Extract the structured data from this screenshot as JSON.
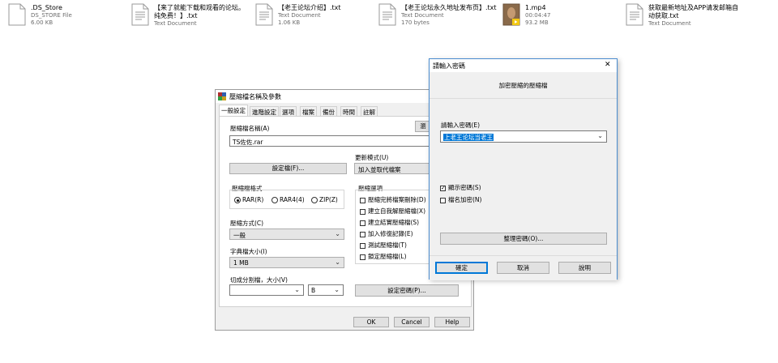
{
  "files": [
    {
      "name": ".DS_Store",
      "line2": "DS_STORE File",
      "line3": "6.00 KB",
      "icon": "blank-file-icon"
    },
    {
      "name": "【来了就能下载和观看的论坛。",
      "line2": "纯免费！】.txt",
      "line3": "Text Document",
      "icon": "text-file-icon"
    },
    {
      "name": "【老王论坛介绍】.txt",
      "line2": "Text Document",
      "line3": "1.06 KB",
      "icon": "text-file-icon"
    },
    {
      "name": "【老王论坛永久地址发布页】.txt",
      "line2": "Text Document",
      "line3": "170 bytes",
      "icon": "text-file-icon"
    },
    {
      "name": "1.mp4",
      "line2": "00:04:47",
      "line3": "93.2 MB",
      "icon": "video-thumbnail-icon"
    },
    {
      "name": "获取最新地址及APP请发邮箱自",
      "line2": "动获取.txt",
      "line3": "Text Document",
      "icon": "text-file-icon"
    }
  ],
  "archive_dialog": {
    "title": "壓縮檔名稱及參數",
    "tabs": [
      "一般設定",
      "進階設定",
      "選項",
      "檔案",
      "備份",
      "時間",
      "註解"
    ],
    "archive_name_label": "壓縮檔名稱(A)",
    "archive_name_value": "TS佐佐.rar",
    "browse_button": "瀏",
    "profiles_button": "設定檔(F)...",
    "update_mode_label": "更新模式(U)",
    "update_mode_value": "加入並取代檔案",
    "format_group_label": "壓縮檔格式",
    "formats": [
      "RAR(R)",
      "RAR4(4)",
      "ZIP(Z)"
    ],
    "method_label": "壓縮方式(C)",
    "method_value": "一般",
    "dict_label": "字典檔大小(I)",
    "dict_value": "1 MB",
    "split_label": "切成分割檔，大小(V)",
    "split_unit": "B",
    "options_group_label": "壓縮選項",
    "options": [
      "壓縮完將檔案刪除(D)",
      "建立自我解壓縮檔(X)",
      "建立結實壓縮檔(S)",
      "加入修復記錄(E)",
      "測試壓縮檔(T)",
      "鎖定壓縮檔(L)"
    ],
    "set_password_button": "設定密碼(P)...",
    "ok_button": "OK",
    "cancel_button": "Cancel",
    "help_button": "Help"
  },
  "password_dialog": {
    "title": "請輸入密碼",
    "close_glyph": "✕",
    "heading": "加密壓縮的壓縮檔",
    "enter_label": "請輸入密碼(E)",
    "password_value": "上老王论坛当老王",
    "show_password_label": "顯示密碼(S)",
    "encrypt_names_label": "檔名加密(N)",
    "organize_button": "整理密碼(O)...",
    "ok_button": "確定",
    "cancel_button": "取消",
    "help_button": "說明"
  },
  "colors": {
    "accent": "#0078d7",
    "selection": "#0078d7",
    "video_badge": "#f2c811"
  }
}
